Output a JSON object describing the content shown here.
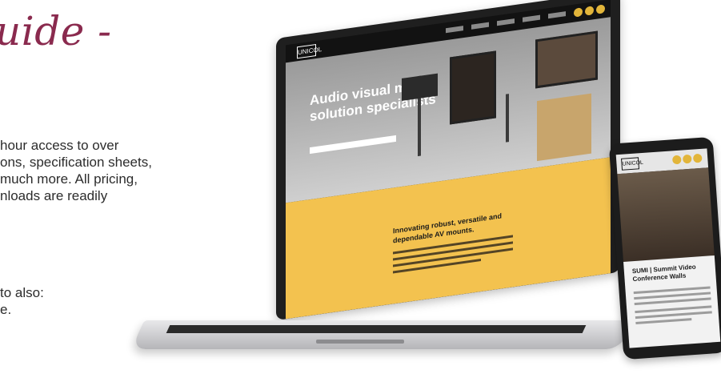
{
  "heading": "uide -",
  "paragraph1_lines": [
    "hour access to over",
    "ons, specification sheets,",
    "much more. All pricing,",
    "nloads are readily"
  ],
  "paragraph2_lines": [
    "to also:",
    "e."
  ],
  "laptop": {
    "logo": "UNICOL",
    "hero_title_lines": [
      "Audio visual mount",
      "solution specialists"
    ],
    "yellow_title_lines": [
      "Innovating robust, versatile and",
      "dependable AV mounts."
    ]
  },
  "phone": {
    "logo": "UNICOL",
    "card_title": "SUMI | Summit Video Conference Walls"
  },
  "colors": {
    "heading": "#8a2a4e",
    "accent_yellow": "#f3c24f",
    "nav_dots": "#e2b53a"
  }
}
